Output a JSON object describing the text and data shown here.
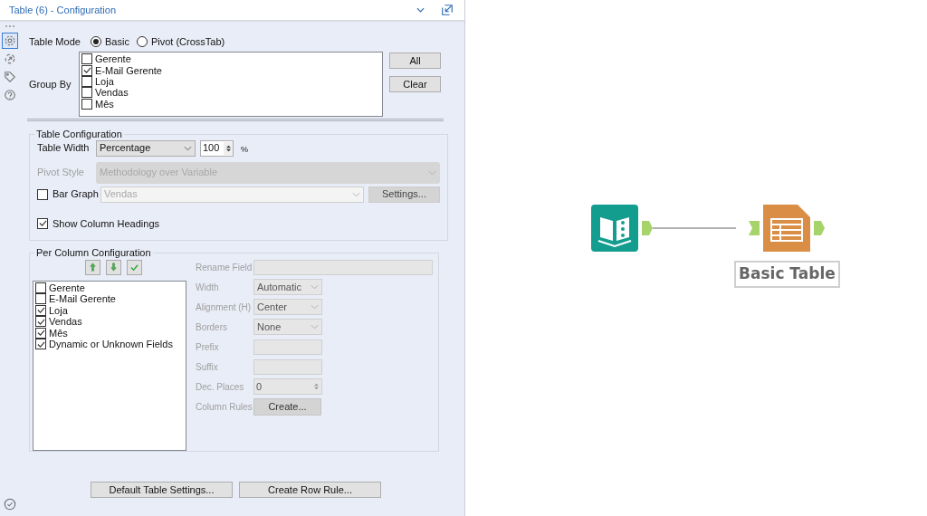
{
  "panel": {
    "title": "Table (6) - Configuration"
  },
  "sidebar_icons": [
    {
      "kind": "settings",
      "selected": true
    },
    {
      "kind": "connections",
      "selected": false
    },
    {
      "kind": "tag",
      "selected": false
    },
    {
      "kind": "help",
      "selected": false
    }
  ],
  "table_mode": {
    "label": "Table Mode",
    "options": [
      {
        "label": "Basic",
        "selected": true
      },
      {
        "label": "Pivot (CrossTab)",
        "selected": false
      }
    ]
  },
  "group_by": {
    "label": "Group By",
    "fields": [
      {
        "label": "Gerente",
        "checked": false
      },
      {
        "label": "E-Mail Gerente",
        "checked": true
      },
      {
        "label": "Loja",
        "checked": false
      },
      {
        "label": "Vendas",
        "checked": false
      },
      {
        "label": "Mês",
        "checked": false
      }
    ],
    "buttons": [
      "All",
      "Clear"
    ]
  },
  "table_configuration": {
    "title": "Table Configuration",
    "table_width": {
      "label": "Table Width",
      "value": "Percentage",
      "number": "100",
      "unit": "%"
    },
    "pivot_style": {
      "label": "Pivot Style",
      "value": "Methodology over Variable",
      "disabled": true
    },
    "bar_graph": {
      "label": "Bar Graph",
      "checked": false,
      "value": "Vendas",
      "button": "Settings..."
    },
    "show_column_headings": {
      "label": "Show Column Headings",
      "checked": true
    }
  },
  "per_column": {
    "title": "Per Column Configuration",
    "disabled": true,
    "fields": [
      {
        "label": "Gerente",
        "checked": false
      },
      {
        "label": "E-Mail Gerente",
        "checked": false
      },
      {
        "label": "Loja",
        "checked": true
      },
      {
        "label": "Vendas",
        "checked": true
      },
      {
        "label": "Mês",
        "checked": true
      },
      {
        "label": "Dynamic or Unknown Fields",
        "checked": true
      }
    ],
    "properties": [
      {
        "kind": "text",
        "label": "Rename Field"
      },
      {
        "kind": "select",
        "label": "Width",
        "value": "Automatic"
      },
      {
        "kind": "select",
        "label": "Alignment (H)",
        "value": "Center"
      },
      {
        "kind": "select",
        "label": "Borders",
        "value": "None"
      },
      {
        "kind": "short",
        "label": "Prefix"
      },
      {
        "kind": "short",
        "label": "Suffix"
      },
      {
        "kind": "number",
        "label": "Dec. Places",
        "value": "0"
      },
      {
        "kind": "button",
        "label": "Column Rules",
        "value": "Create..."
      }
    ]
  },
  "footer_buttons": [
    "Default Table Settings...",
    "Create Row Rule..."
  ],
  "canvas": {
    "nodes": [
      {
        "kind": "input"
      },
      {
        "kind": "table",
        "label": "Basic Table"
      }
    ]
  }
}
